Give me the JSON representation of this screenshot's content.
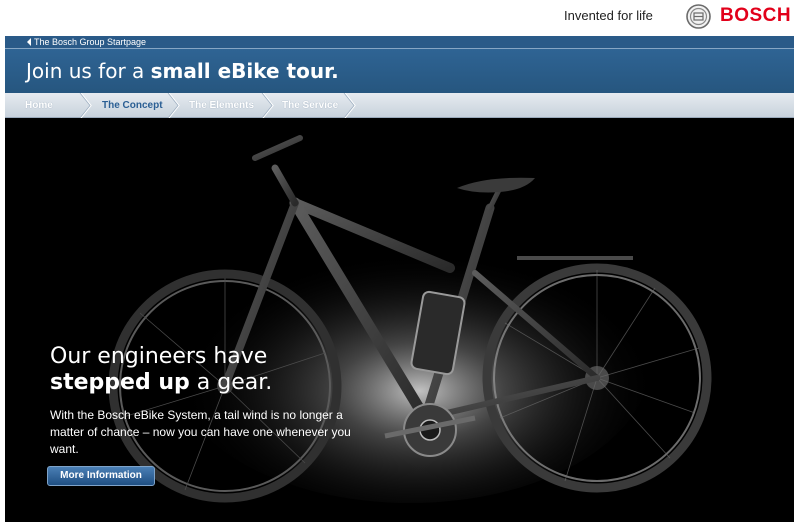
{
  "brand": {
    "slogan": "Invented for life",
    "logo_text": "BOSCH",
    "logo_color": "#e2001a"
  },
  "startbar": {
    "label": "The Bosch Group Startpage",
    "icon": "arrow-left-icon"
  },
  "header": {
    "title_regular": "Join us for a ",
    "title_bold": "small eBike tour."
  },
  "nav": {
    "items": [
      {
        "label": "Home",
        "state": "inactive"
      },
      {
        "label": "The Concept",
        "state": "active"
      },
      {
        "label": "The Elements",
        "state": "inactive"
      },
      {
        "label": "The Service",
        "state": "inactive"
      }
    ]
  },
  "hero": {
    "line1": "Our engineers have",
    "line2_bold": "stepped up",
    "line2_regular": " a gear.",
    "body": "With the Bosch eBike System, a tail wind is no longer a matter of chance – now you can have one whenever you want.",
    "button_label": "More Information"
  },
  "colors": {
    "header_blue": "#2a5a88",
    "nav_active": "#2b5f94",
    "hero_bg": "#000000"
  }
}
